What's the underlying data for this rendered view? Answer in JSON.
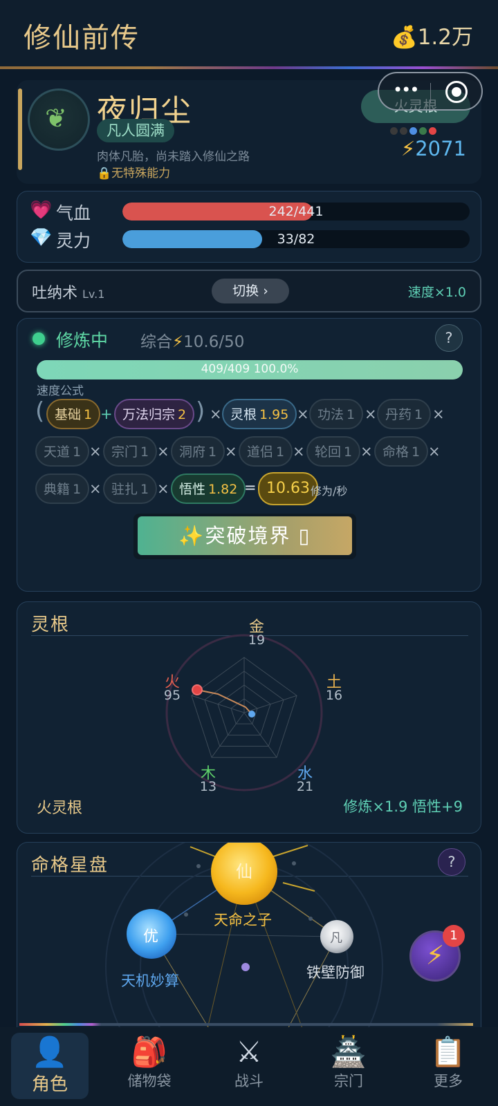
{
  "header": {
    "title": "修仙前传",
    "money": "1.2万",
    "money_icon": "money-bag-icon"
  },
  "profile": {
    "name": "夜归尘",
    "realm": "凡人圆满",
    "description": "肉体凡胎，尚未踏入修仙之路",
    "ability": "无特殊能力",
    "spirit_root_badge": "火灵根",
    "root_dot_colors": [
      "#3a3a3a",
      "#3a3a3a",
      "#4f8fe3",
      "#3a7a4a",
      "#e34545"
    ],
    "power": "2071"
  },
  "stats": {
    "hp": {
      "label": "气血",
      "text": "242/441",
      "value": 242,
      "max": 441,
      "color": "#d9534f"
    },
    "mp": {
      "label": "灵力",
      "text": "33/82",
      "value": 33,
      "max": 82,
      "color": "#4a9edb"
    }
  },
  "technique": {
    "name": "吐纳术",
    "level": "Lv.1",
    "switch_label": "切换 ›",
    "speed": "速度×1.0"
  },
  "cultivation": {
    "status": "修炼中",
    "overall_prefix": "综合",
    "overall_value": "10.6/50",
    "progress_text": "409/409  100.0%",
    "progress_fraction": 1.0,
    "formula_label": "速度公式",
    "chips": {
      "base": {
        "label": "基础",
        "value": "1"
      },
      "wanfa": {
        "label": "万法归宗",
        "value": "2"
      },
      "linggen": {
        "label": "灵根",
        "value": "1.95"
      },
      "gongfa": {
        "label": "功法",
        "value": "1"
      },
      "danyao": {
        "label": "丹药",
        "value": "1"
      },
      "tiandao": {
        "label": "天道",
        "value": "1"
      },
      "zongmen": {
        "label": "宗门",
        "value": "1"
      },
      "dongfu": {
        "label": "洞府",
        "value": "1"
      },
      "daolv": {
        "label": "道侣",
        "value": "1"
      },
      "lunhui": {
        "label": "轮回",
        "value": "1"
      },
      "mingge": {
        "label": "命格",
        "value": "1"
      },
      "dianji": {
        "label": "典籍",
        "value": "1"
      },
      "zhuzha": {
        "label": "驻扎",
        "value": "1"
      },
      "wuxing": {
        "label": "悟性",
        "value": "1.82"
      }
    },
    "result": "10.63",
    "result_unit": "修为/秒",
    "breakthrough_label": "✨突破境界 ▯"
  },
  "spirit_root": {
    "title": "灵根",
    "elements": {
      "jin": {
        "label": "金",
        "value": 19,
        "color": "#e8c98a"
      },
      "tu": {
        "label": "土",
        "value": 16,
        "color": "#e8b24f"
      },
      "shui": {
        "label": "水",
        "value": 21,
        "color": "#5fa8ef"
      },
      "mu": {
        "label": "木",
        "value": 13,
        "color": "#5fd06a"
      },
      "huo": {
        "label": "火",
        "value": 95,
        "color": "#e35f4f"
      }
    },
    "root_name": "火灵根",
    "bonus": "修炼×1.9  悟性+9"
  },
  "star_chart": {
    "title": "命格星盘",
    "orbs": {
      "xian": {
        "glyph": "仙",
        "label": "天命之子"
      },
      "you": {
        "glyph": "优",
        "label": "天机妙算"
      },
      "fan": {
        "glyph": "凡",
        "label": "铁壁防御"
      }
    },
    "energy_badge": "1"
  },
  "nav": [
    {
      "label": "角色",
      "icon": "character-icon"
    },
    {
      "label": "储物袋",
      "icon": "backpack-icon"
    },
    {
      "label": "战斗",
      "icon": "crossed-swords-icon"
    },
    {
      "label": "宗门",
      "icon": "pagoda-icon"
    },
    {
      "label": "更多",
      "icon": "clipboard-icon"
    }
  ]
}
